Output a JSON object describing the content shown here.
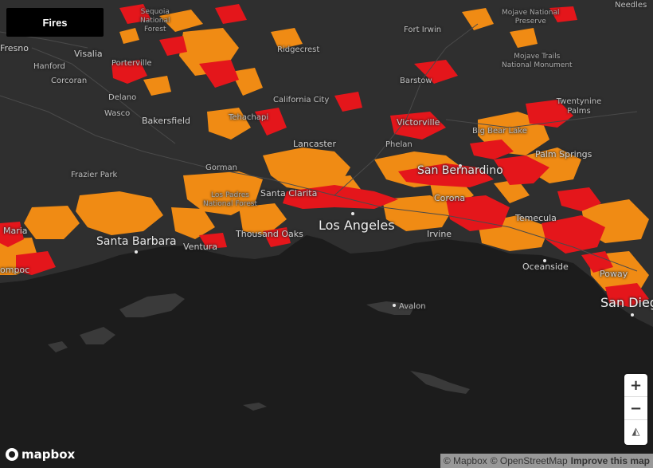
{
  "layer_button": {
    "label": "Fires"
  },
  "colors": {
    "land": "#2f2f2f",
    "water": "#1c1c1c",
    "fire_high": "#e4161b",
    "fire_moderate": "#f08b14"
  },
  "map": {
    "labels": [
      {
        "id": "fresno",
        "text": "Fresno",
        "size": "md"
      },
      {
        "id": "visalia",
        "text": "Visalia",
        "size": "md"
      },
      {
        "id": "hanford",
        "text": "Hanford",
        "size": "sm"
      },
      {
        "id": "corcoran",
        "text": "Corcoran",
        "size": "sm"
      },
      {
        "id": "delano",
        "text": "Delano",
        "size": "sm"
      },
      {
        "id": "porterville",
        "text": "Porterville",
        "size": "sm"
      },
      {
        "id": "wasco",
        "text": "Wasco",
        "size": "sm"
      },
      {
        "id": "bakersfield",
        "text": "Bakersfield",
        "size": "md"
      },
      {
        "id": "tehachapi",
        "text": "Tehachapi",
        "size": "sm"
      },
      {
        "id": "california-city",
        "text": "California City",
        "size": "sm"
      },
      {
        "id": "ridgecrest",
        "text": "Ridgecrest",
        "size": "sm"
      },
      {
        "id": "fort-irwin",
        "text": "Fort Irwin",
        "size": "sm"
      },
      {
        "id": "barstow",
        "text": "Barstow",
        "size": "sm"
      },
      {
        "id": "victorville",
        "text": "Victorville",
        "size": "md"
      },
      {
        "id": "big-bear-lake",
        "text": "Big Bear Lake",
        "size": "sm"
      },
      {
        "id": "twentynine-palms",
        "text": "Twentynine Palms",
        "size": "sm"
      },
      {
        "id": "palm-springs",
        "text": "Palm Springs",
        "size": "md"
      },
      {
        "id": "lancaster",
        "text": "Lancaster",
        "size": "md"
      },
      {
        "id": "phelan",
        "text": "Phelan",
        "size": "sm"
      },
      {
        "id": "san-bernardino",
        "text": "San Bernardino",
        "size": "lg"
      },
      {
        "id": "corona",
        "text": "Corona",
        "size": "md"
      },
      {
        "id": "temecula",
        "text": "Temecula",
        "size": "md"
      },
      {
        "id": "irvine",
        "text": "Irvine",
        "size": "md"
      },
      {
        "id": "oceanside",
        "text": "Oceanside",
        "size": "md"
      },
      {
        "id": "poway",
        "text": "Poway",
        "size": "md"
      },
      {
        "id": "san-diego",
        "text": "San Dieg",
        "size": "xl"
      },
      {
        "id": "los-angeles",
        "text": "Los Angeles",
        "size": "xl"
      },
      {
        "id": "santa-clarita",
        "text": "Santa Clarita",
        "size": "md"
      },
      {
        "id": "gorman",
        "text": "Gorman",
        "size": "sm"
      },
      {
        "id": "frazier-park",
        "text": "Frazier Park",
        "size": "sm"
      },
      {
        "id": "thousand-oaks",
        "text": "Thousand Oaks",
        "size": "md"
      },
      {
        "id": "ventura",
        "text": "Ventura",
        "size": "md"
      },
      {
        "id": "santa-barbara",
        "text": "Santa Barbara",
        "size": "lg"
      },
      {
        "id": "santa-maria",
        "text": "Maria",
        "size": "md"
      },
      {
        "id": "lompoc",
        "text": "ompoc",
        "size": "md"
      },
      {
        "id": "avalon",
        "text": "Avalon",
        "size": "sm"
      },
      {
        "id": "needles",
        "text": "Needles",
        "size": "sm"
      }
    ],
    "areas": [
      {
        "id": "sequoia",
        "text": "Sequoia\nNational\nForest"
      },
      {
        "id": "mojave-preserve",
        "text": "Mojave National\nPreserve"
      },
      {
        "id": "mojave-trails",
        "text": "Mojave Trails\nNational Monument"
      },
      {
        "id": "los-padres",
        "text": "Los Padres\nNational Forest"
      }
    ]
  },
  "controls": {
    "zoom_in": "+",
    "zoom_out": "−",
    "compass": "◭"
  },
  "logo": {
    "text": "mapbox"
  },
  "attribution": {
    "mapbox": "© Mapbox",
    "osm": "© OpenStreetMap",
    "improve": "Improve this map"
  }
}
